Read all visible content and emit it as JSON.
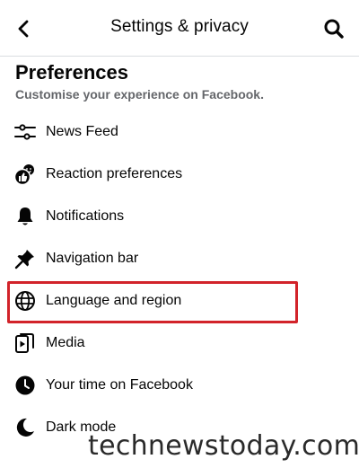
{
  "header": {
    "title": "Settings & privacy",
    "back_icon": "back-arrow-icon",
    "search_icon": "search-icon"
  },
  "section": {
    "title": "Preferences",
    "subtitle": "Customise your experience on Facebook."
  },
  "items": [
    {
      "label": "News Feed",
      "icon": "sliders-icon"
    },
    {
      "label": "Reaction preferences",
      "icon": "reactions-icon"
    },
    {
      "label": "Notifications",
      "icon": "bell-icon"
    },
    {
      "label": "Navigation bar",
      "icon": "pin-icon"
    },
    {
      "label": "Language and region",
      "icon": "globe-icon",
      "highlighted": true
    },
    {
      "label": "Media",
      "icon": "media-icon"
    },
    {
      "label": "Your time on Facebook",
      "icon": "clock-icon"
    },
    {
      "label": "Dark mode",
      "icon": "moon-icon"
    }
  ],
  "highlight_color": "#d2232a",
  "watermark": "technewstoday.com"
}
